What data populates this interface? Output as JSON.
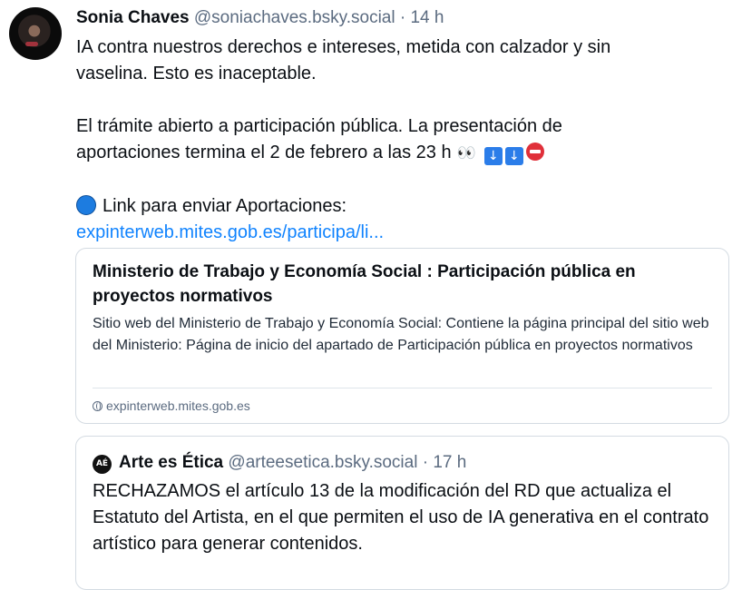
{
  "post": {
    "author_name": "Sonia Chaves",
    "handle": "@soniachaves.bsky.social",
    "separator": "·",
    "time": "14 h",
    "line1": "IA contra nuestros derechos e intereses, metida con calzador y sin",
    "line2": "vaselina. Esto es inaceptable.",
    "line3": "El trámite abierto a participación pública. La presentación de",
    "line4": "aportaciones termina el 2 de febrero a las 23 h",
    "emoji_eyes": "👀",
    "emoji_down": "↓",
    "line5": "Link para enviar Aportaciones:",
    "link": "expinterweb.mites.gob.es/participa/li..."
  },
  "link_card": {
    "title": "Ministerio de Trabajo y Economía Social : Participación pública en proyectos normativos",
    "description": "Sitio web del Ministerio de Trabajo y Economía Social: Contiene la página principal del sitio web del Ministerio: Página de inicio del apartado de Participación pública en proyectos normativos",
    "domain": "expinterweb.mites.gob.es"
  },
  "quoted_post": {
    "avatar_text": "AÉ",
    "author_name": "Arte es Ética",
    "handle": "@arteesetica.bsky.social",
    "separator": "·",
    "time": "17 h",
    "body": "RECHAZAMOS el artículo 13 de la modificación del RD que actualiza el Estatuto del Artista, en el que permiten el uso de IA generativa en el contrato artístico para generar contenidos."
  },
  "colors": {
    "link": "#1083fe",
    "muted_text": "#5b6b80",
    "border": "#d4dbe2"
  }
}
